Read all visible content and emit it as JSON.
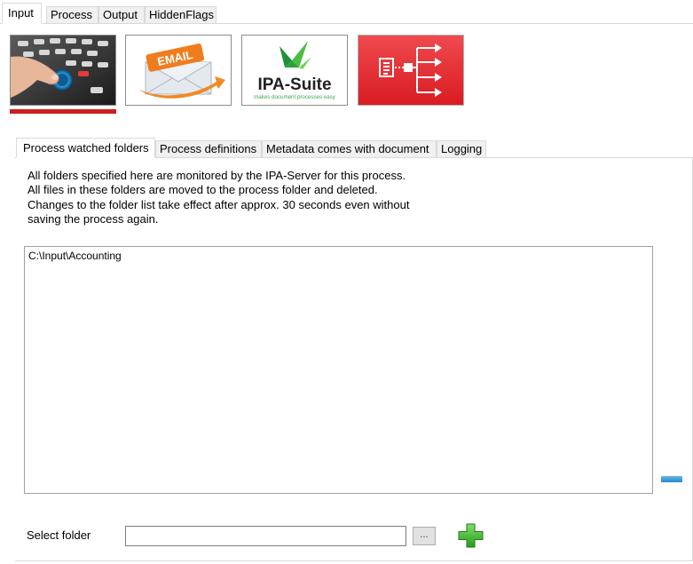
{
  "top_tabs": {
    "input": "Input",
    "process": "Process",
    "output": "Output",
    "hidden_flags": "HiddenFlags"
  },
  "sources": {
    "email_word": "EMAIL",
    "ipa_word": "IPA-Suite",
    "ipa_tagline": "makes document processes easy"
  },
  "inner_tabs": {
    "watched": "Process watched folders",
    "definitions": "Process definitions",
    "metadata": "Metadata comes with document",
    "logging": "Logging"
  },
  "description": {
    "line1": "All folders specified here are monitored by the IPA-Server for this process.",
    "line2": "All files in these folders are moved to the process folder and deleted.",
    "line3": "Changes to the folder list take effect after approx. 30 seconds even without",
    "line4": "saving the process again."
  },
  "folders": [
    "C:\\Input\\Accounting"
  ],
  "select": {
    "label": "Select folder",
    "value": "",
    "browse_label": "..."
  },
  "colors": {
    "active_indicator": "#cc1f1f",
    "workflow_bg": "#e6262b",
    "add_green": "#3aa52a"
  }
}
